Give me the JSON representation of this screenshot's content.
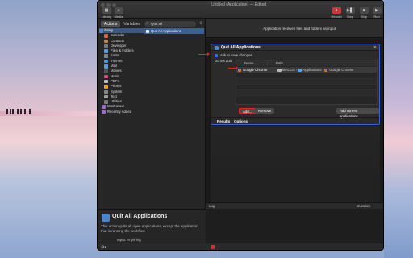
{
  "window": {
    "title": "Untitled (Application) — Edited"
  },
  "toolbar": {
    "library_label": "Library",
    "media_label": "Media",
    "record_label": "Record",
    "step_label": "Step",
    "stop_label": "Stop",
    "run_label": "Run"
  },
  "left": {
    "tabs": [
      "Actions",
      "Variables"
    ],
    "search_value": "Quit all",
    "library": [
      {
        "label": "Library",
        "level": 0,
        "color": "#4a85c9"
      },
      {
        "label": "Calendar",
        "level": 1,
        "color": "#e05a4a"
      },
      {
        "label": "Contacts",
        "level": 1,
        "color": "#b08a5a"
      },
      {
        "label": "Developer",
        "level": 1,
        "color": "#7a7a7a"
      },
      {
        "label": "Files & Folders",
        "level": 1,
        "color": "#5aa0e0"
      },
      {
        "label": "Fonts",
        "level": 1,
        "color": "#888888"
      },
      {
        "label": "Internet",
        "level": 1,
        "color": "#4a9ae0"
      },
      {
        "label": "Mail",
        "level": 1,
        "color": "#5aa0e0"
      },
      {
        "label": "Movies",
        "level": 1,
        "color": "#555555"
      },
      {
        "label": "Music",
        "level": 1,
        "color": "#e04a7a"
      },
      {
        "label": "PDFs",
        "level": 1,
        "color": "#c0c0c0"
      },
      {
        "label": "Photos",
        "level": 1,
        "color": "#e0a04a"
      },
      {
        "label": "System",
        "level": 1,
        "color": "#8a8a8a"
      },
      {
        "label": "Text",
        "level": 1,
        "color": "#a0a0a0"
      },
      {
        "label": "Utilities",
        "level": 1,
        "color": "#7a7a7a"
      },
      {
        "label": "Most Used",
        "level": 0,
        "color": "#9a6ad0"
      },
      {
        "label": "Recently Added",
        "level": 0,
        "color": "#9a6ad0"
      }
    ],
    "action_result": "Quit All Applications",
    "description": {
      "title": "Quit All Applications",
      "text": "This action quits all open applications, except the application that is running the workflow.",
      "input_label": "Input:",
      "input_value": "Anything",
      "options_label": "Options:",
      "options_value": "You can provide options to save changes and"
    }
  },
  "right": {
    "info": "Application receives files and folders as input",
    "card": {
      "title": "Quit All Applications",
      "ask_label": "Ask to save changes",
      "do_not_quit_label": "Do not quit:",
      "columns": [
        "Name",
        "Path"
      ],
      "row": {
        "name": "Google Chrome",
        "path_disk": "MACOS",
        "path_folder": "Applications",
        "path_app": "Google Chrome"
      },
      "add_label": "Add...",
      "remove_label": "Remove",
      "add_current_label": "Add current applications",
      "results_label": "Results",
      "options_label": "Options"
    },
    "log": {
      "col_log": "Log",
      "col_duration": "Duration"
    }
  },
  "colors": {
    "accent": "#3a6fd6",
    "highlight": "#e22222",
    "selection": "#3a5f99"
  }
}
